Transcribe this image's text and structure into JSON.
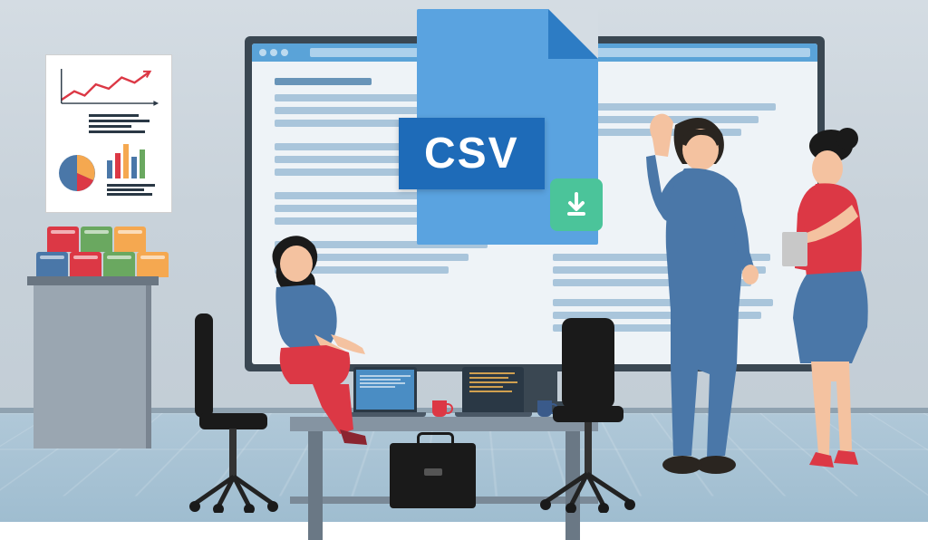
{
  "csv_label": "CSV",
  "colors": {
    "csv_file": "#5aa3e0",
    "csv_badge": "#1e6bb8",
    "download": "#4bc49a",
    "red": "#dc3845",
    "blue": "#4a77a8",
    "dark": "#1a1a1a"
  },
  "poster": {
    "pie_segments": [
      "#dc3845",
      "#f5a850",
      "#4a77a8"
    ],
    "bar_colors": [
      "#4a77a8",
      "#dc3845",
      "#f5a850",
      "#4a77a8",
      "#6aa860"
    ]
  },
  "binders": [
    [
      "#dc3845",
      "#6aa860",
      "#f5a850"
    ],
    [
      "#4a77a8",
      "#dc3845",
      "#6aa860",
      "#f5a850"
    ]
  ]
}
